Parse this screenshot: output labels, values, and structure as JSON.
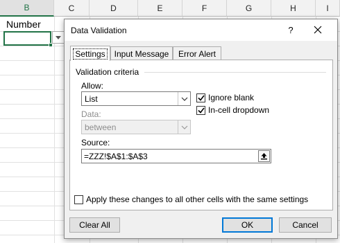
{
  "sheet": {
    "columns": [
      "B",
      "C",
      "D",
      "E",
      "F",
      "G",
      "H",
      "I"
    ],
    "selected_column": "B",
    "cell_b1_value": "Number"
  },
  "dialog": {
    "title": "Data Validation",
    "help_label": "?",
    "tabs": [
      {
        "label": "Settings",
        "active": true
      },
      {
        "label": "Input Message",
        "active": false
      },
      {
        "label": "Error Alert",
        "active": false
      }
    ],
    "group_title": "Validation criteria",
    "allow": {
      "label": "Allow:",
      "value": "List"
    },
    "data": {
      "label": "Data:",
      "value": "between",
      "disabled": true
    },
    "ignore_blank": {
      "label": "Ignore blank",
      "checked": true
    },
    "in_cell_dropdown": {
      "label": "In-cell dropdown",
      "checked": true
    },
    "source": {
      "label": "Source:",
      "value": "=ZZZ!$A$1:$A$3"
    },
    "apply_all": {
      "label": "Apply these changes to all other cells with the same settings",
      "checked": false
    },
    "buttons": {
      "clear_all": "Clear All",
      "ok": "OK",
      "cancel": "Cancel"
    }
  },
  "colors": {
    "excel_green": "#217346",
    "focus_blue": "#0078d7",
    "dialog_bg": "#f0f0f0"
  }
}
